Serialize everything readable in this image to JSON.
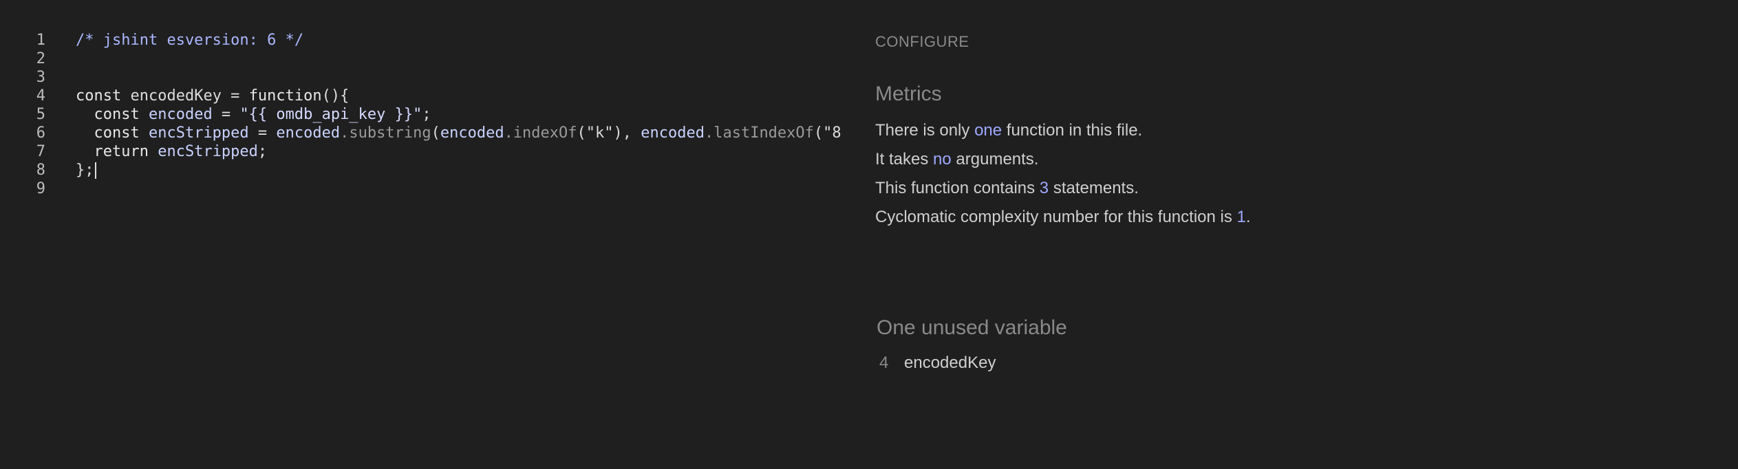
{
  "editor": {
    "lines": [
      {
        "num": "1",
        "tokens": [
          {
            "t": "/* jshint esversion: 6 */",
            "c": "comment"
          }
        ]
      },
      {
        "num": "2",
        "tokens": []
      },
      {
        "num": "3",
        "tokens": []
      },
      {
        "num": "4",
        "tokens": [
          {
            "t": "const ",
            "c": "kw"
          },
          {
            "t": "encodedKey",
            "c": "plain"
          },
          {
            "t": " = ",
            "c": "plain"
          },
          {
            "t": "function",
            "c": "kw"
          },
          {
            "t": "(){",
            "c": "plain"
          }
        ]
      },
      {
        "num": "5",
        "tokens": [
          {
            "t": "  const ",
            "c": "kw"
          },
          {
            "t": "encoded",
            "c": "var"
          },
          {
            "t": " = ",
            "c": "plain"
          },
          {
            "t": "\"{{ omdb_api_key }}\"",
            "c": "str"
          },
          {
            "t": ";",
            "c": "plain"
          }
        ]
      },
      {
        "num": "6",
        "tokens": [
          {
            "t": "  const ",
            "c": "kw"
          },
          {
            "t": "encStripped",
            "c": "var"
          },
          {
            "t": " = ",
            "c": "plain"
          },
          {
            "t": "encoded",
            "c": "var"
          },
          {
            "t": ".substring",
            "c": "method"
          },
          {
            "t": "(",
            "c": "plain"
          },
          {
            "t": "encoded",
            "c": "var"
          },
          {
            "t": ".indexOf",
            "c": "method"
          },
          {
            "t": "(\"k\"), ",
            "c": "plain"
          },
          {
            "t": "encoded",
            "c": "var"
          },
          {
            "t": ".lastIndexOf",
            "c": "method"
          },
          {
            "t": "(\"8",
            "c": "plain"
          }
        ]
      },
      {
        "num": "7",
        "tokens": [
          {
            "t": "  return ",
            "c": "kw"
          },
          {
            "t": "encStripped",
            "c": "var"
          },
          {
            "t": ";",
            "c": "plain"
          }
        ]
      },
      {
        "num": "8",
        "tokens": [
          {
            "t": "};",
            "c": "plain"
          }
        ],
        "cursor": true
      },
      {
        "num": "9",
        "tokens": []
      }
    ]
  },
  "panel": {
    "configure_label": "CONFIGURE",
    "metrics_title": "Metrics",
    "metrics": [
      {
        "parts": [
          {
            "t": "There is only "
          },
          {
            "t": "one",
            "hl": true
          },
          {
            "t": " function in this file."
          }
        ]
      },
      {
        "parts": [
          {
            "t": "It takes "
          },
          {
            "t": "no",
            "hl": true
          },
          {
            "t": " arguments."
          }
        ]
      },
      {
        "parts": [
          {
            "t": "This function contains "
          },
          {
            "t": "3",
            "hl": true
          },
          {
            "t": " statements."
          }
        ]
      },
      {
        "parts": [
          {
            "t": "Cyclomatic complexity number for this function is "
          },
          {
            "t": "1",
            "hl": true
          },
          {
            "t": "."
          }
        ]
      }
    ],
    "unused_title": "One unused variable",
    "unused": [
      {
        "line": "4",
        "name": "encodedKey"
      }
    ]
  }
}
